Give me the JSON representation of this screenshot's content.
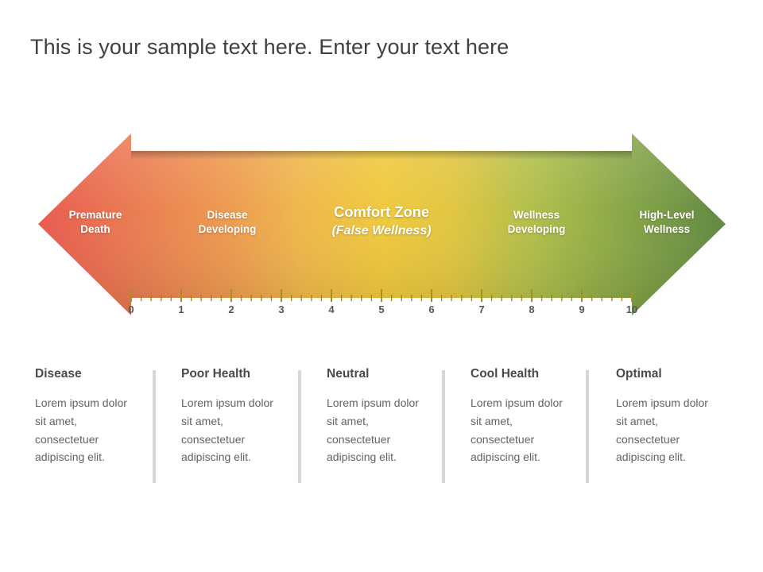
{
  "title": "This is your sample text here. Enter your text here",
  "continuum": {
    "direction": "bidirectional-arrow",
    "colors": {
      "stop_0": "#E8584E",
      "stop_1": "#ED9A4E",
      "stop_2": "#EFC83A",
      "stop_3": "#AFBE48",
      "stop_4": "#5E8640"
    },
    "zones": [
      {
        "line1": "Premature",
        "line2": "Death",
        "style": "small"
      },
      {
        "line1": "Disease",
        "line2": "Developing",
        "style": "small"
      },
      {
        "line1": "Comfort Zone",
        "line2": "(False Wellness)",
        "style": "emphasis"
      },
      {
        "line1": "Wellness",
        "line2": "Developing",
        "style": "small"
      },
      {
        "line1": "High-Level",
        "line2": "Wellness",
        "style": "small"
      }
    ]
  },
  "scale": {
    "min": 0,
    "max": 10,
    "minor_ticks_between": 4,
    "tick_labels": [
      "0",
      "1",
      "2",
      "3",
      "4",
      "5",
      "6",
      "7",
      "8",
      "9",
      "10"
    ],
    "tick_color": "#9a8a28",
    "label_color": "#55585A"
  },
  "columns": [
    {
      "heading": "Disease",
      "body": "Lorem ipsum dolor sit amet, consectetuer adipiscing elit."
    },
    {
      "heading": "Poor Health",
      "body": "Lorem ipsum dolor sit amet, consectetuer adipiscing elit."
    },
    {
      "heading": "Neutral",
      "body": "Lorem ipsum dolor sit amet, consectetuer adipiscing elit."
    },
    {
      "heading": "Cool Health",
      "body": "Lorem ipsum dolor sit amet, consectetuer adipiscing elit."
    },
    {
      "heading": "Optimal",
      "body": "Lorem ipsum dolor sit amet, consectetuer adipiscing elit."
    }
  ],
  "chart_data": {
    "type": "bar",
    "title": "Wellness Continuum",
    "xlabel": "",
    "ylabel": "",
    "categories": [
      "Premature Death",
      "Disease Developing",
      "Comfort Zone (False Wellness)",
      "Wellness Developing",
      "High-Level Wellness"
    ],
    "values": [
      1,
      3,
      5,
      7,
      9
    ],
    "xlim": [
      0,
      10
    ],
    "grid": false,
    "legend": "none",
    "tick_labels": [
      "0",
      "1",
      "2",
      "3",
      "4",
      "5",
      "6",
      "7",
      "8",
      "9",
      "10"
    ]
  }
}
